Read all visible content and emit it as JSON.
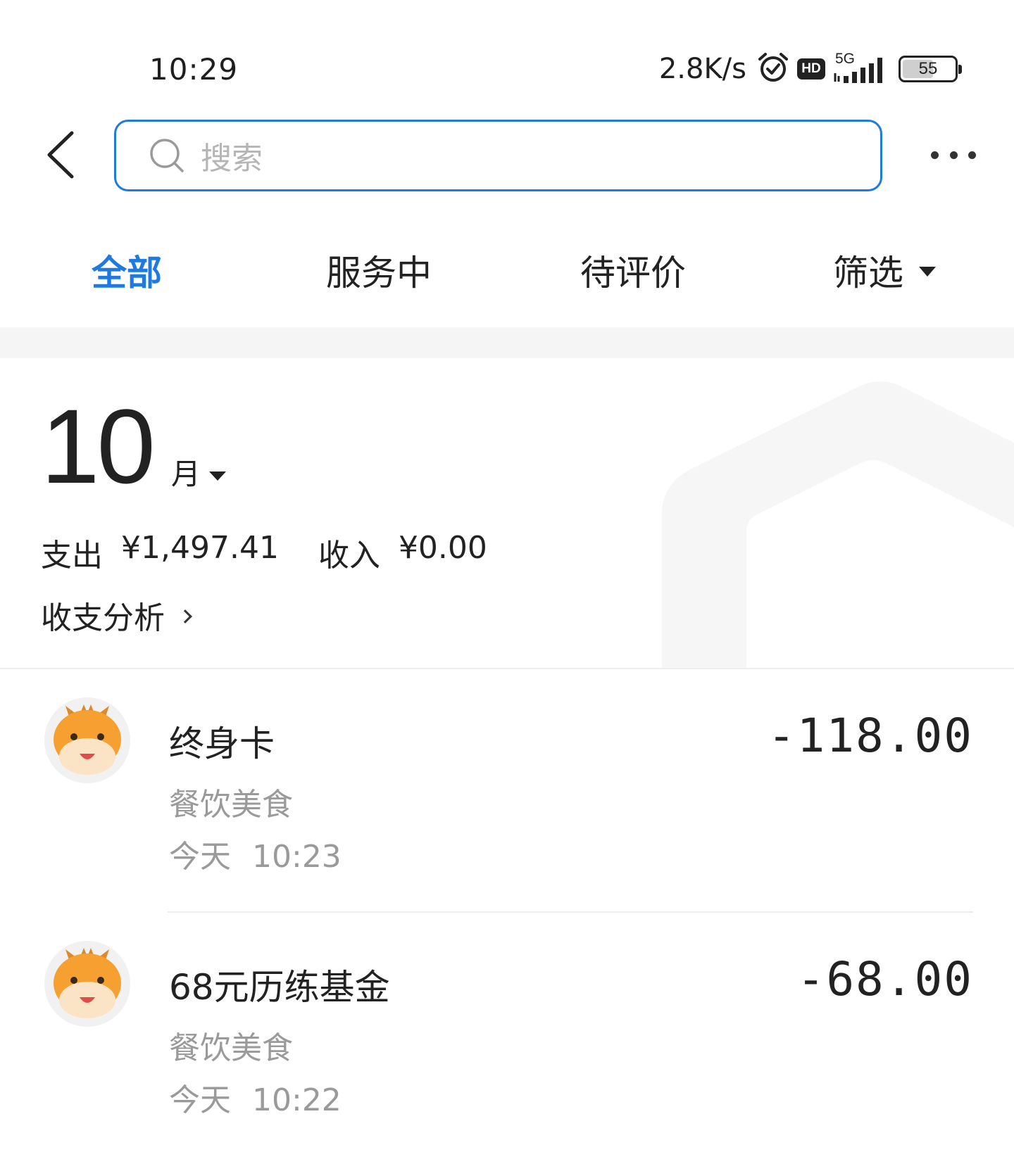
{
  "status_bar": {
    "time": "10:29",
    "net_speed": "2.8K/s",
    "hd_label": "HD",
    "network_type": "5G",
    "battery_level": "55",
    "icons": [
      "alarm-icon",
      "hd-icon",
      "signal-icon",
      "battery-icon"
    ]
  },
  "header": {
    "search_placeholder": "搜索",
    "icons": [
      "back-icon",
      "search-icon",
      "more-icon"
    ]
  },
  "tabs": [
    {
      "label": "全部",
      "active": true
    },
    {
      "label": "服务中",
      "active": false
    },
    {
      "label": "待评价",
      "active": false
    },
    {
      "label": "筛选",
      "active": false
    }
  ],
  "summary": {
    "month": "10",
    "month_unit": "月",
    "expense_label": "支出",
    "expense_amount": "¥1,497.41",
    "income_label": "收入",
    "income_amount": "¥0.00",
    "analysis_label": "收支分析"
  },
  "transactions": [
    {
      "title": "终身卡",
      "category": "餐饮美食",
      "day": "今天",
      "time": "10:23",
      "amount": "-118.00"
    },
    {
      "title": "68元历练基金",
      "category": "餐饮美食",
      "day": "今天",
      "time": "10:22",
      "amount": "-68.00"
    }
  ],
  "colors": {
    "accent": "#1f7ae0",
    "text_primary": "#222222",
    "text_secondary": "#9a9a9a",
    "band": "#f5f5f5"
  }
}
